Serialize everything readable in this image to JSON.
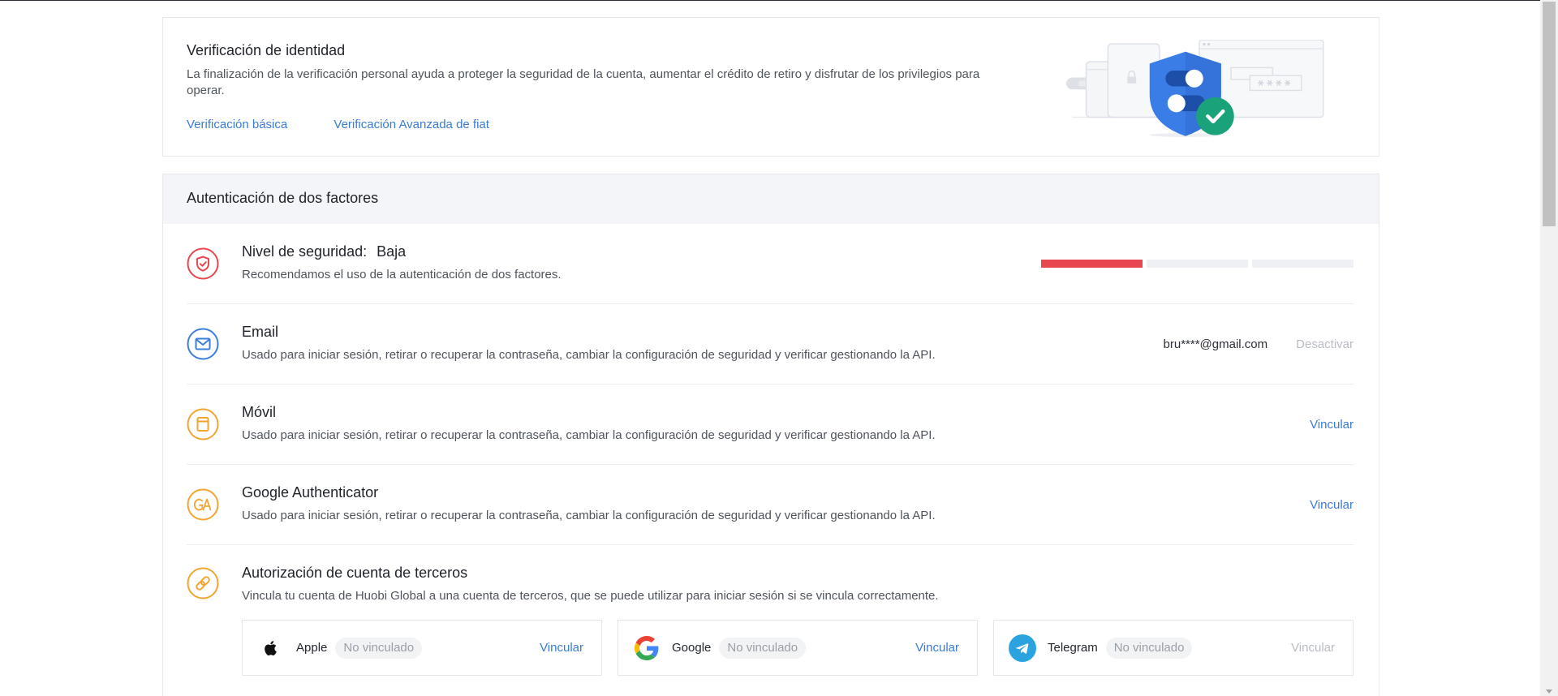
{
  "colors": {
    "link": "#3a7bd5",
    "danger": "#e8474f",
    "warning": "#f2a531",
    "info": "#3d7edb",
    "disabled": "#b8bcc3",
    "success": "#1aa37a"
  },
  "identity": {
    "title": "Verificación de identidad",
    "description": "La finalización de la verificación personal ayuda a proteger la seguridad de la cuenta, aumentar el crédito de retiro y disfrutar de los privilegios para operar.",
    "links": {
      "basic": "Verificación básica",
      "advanced_fiat": "Verificación Avanzada de fiat"
    },
    "illustration_icon": "security-illustration-icon"
  },
  "two_factor": {
    "title": "Autenticación de dos factores",
    "security": {
      "icon": "shield-check-icon",
      "label": "Nivel de seguridad:",
      "value": "Baja",
      "description": "Recomendamos el uso de la autenticación de dos factores.",
      "level_filled": 1,
      "level_total": 3
    },
    "email": {
      "icon": "envelope-icon",
      "title": "Email",
      "description": "Usado para iniciar sesión, retirar o recuperar la contraseña, cambiar la configuración de seguridad y verificar gestionando la API.",
      "account": "bru****@gmail.com",
      "action": "Desactivar",
      "action_enabled": false
    },
    "mobile": {
      "icon": "mobile-icon",
      "title": "Móvil",
      "description": "Usado para iniciar sesión, retirar o recuperar la contraseña, cambiar la configuración de seguridad y verificar gestionando la API.",
      "action": "Vincular",
      "action_enabled": true
    },
    "google_auth": {
      "icon": "google-authenticator-icon",
      "title": "Google Authenticator",
      "description": "Usado para iniciar sesión, retirar o recuperar la contraseña, cambiar la configuración de seguridad y verificar gestionando la API.",
      "action": "Vincular",
      "action_enabled": true
    },
    "third_party": {
      "icon": "link-icon",
      "title": "Autorización de cuenta de terceros",
      "description": "Vincula tu cuenta de Huobi Global a una cuenta de terceros, que se puede utilizar para iniciar sesión si se vincula correctamente.",
      "accounts": [
        {
          "icon": "apple-logo-icon",
          "name": "Apple",
          "status": "No vinculado",
          "action": "Vincular",
          "action_enabled": true
        },
        {
          "icon": "google-logo-icon",
          "name": "Google",
          "status": "No vinculado",
          "action": "Vincular",
          "action_enabled": true
        },
        {
          "icon": "telegram-logo-icon",
          "name": "Telegram",
          "status": "No vinculado",
          "action": "Vincular",
          "action_enabled": false
        }
      ]
    }
  }
}
